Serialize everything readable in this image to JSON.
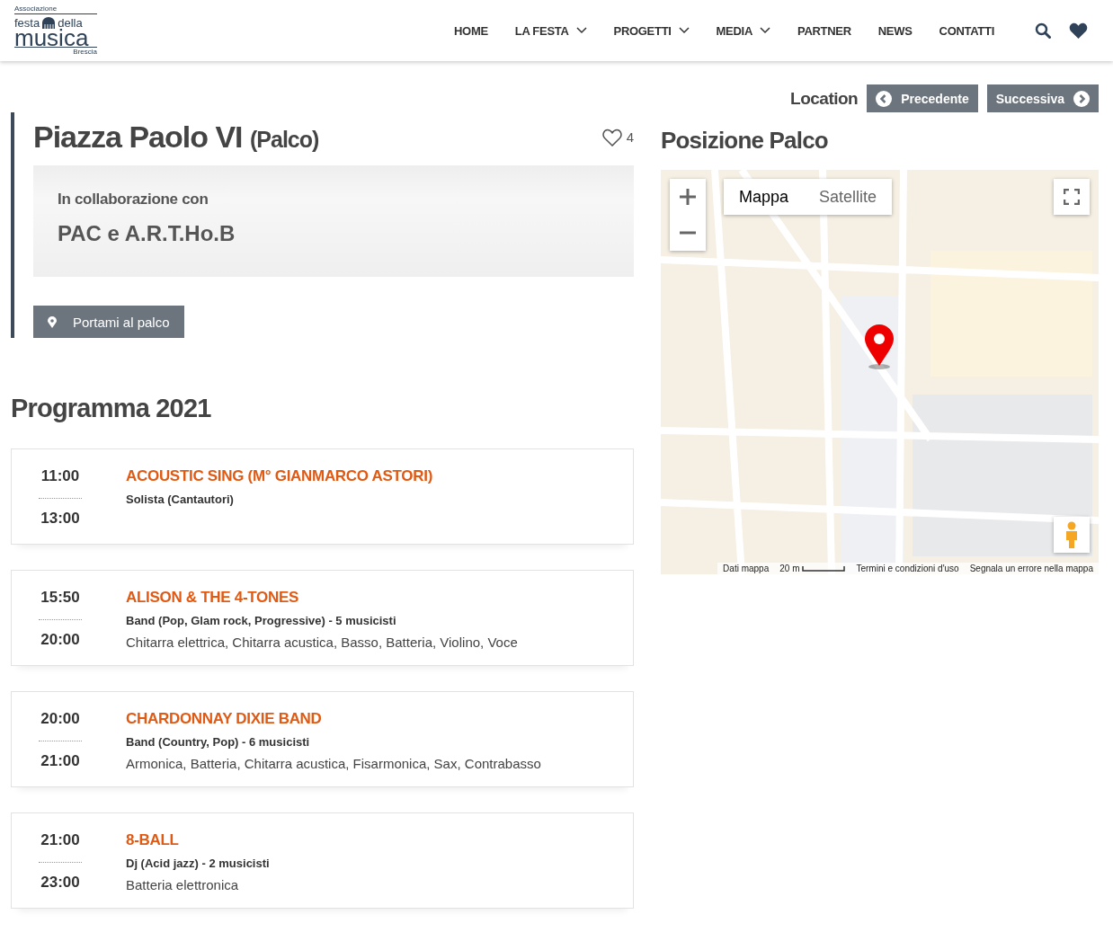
{
  "logo": {
    "top": "Associazione",
    "left": "festa",
    "right": "della",
    "main": "musica",
    "bottom": "Brescia"
  },
  "nav": [
    {
      "label": "HOME",
      "has_dropdown": false
    },
    {
      "label": "LA FESTA",
      "has_dropdown": true
    },
    {
      "label": "PROGETTI",
      "has_dropdown": true
    },
    {
      "label": "MEDIA",
      "has_dropdown": true
    },
    {
      "label": "PARTNER",
      "has_dropdown": false
    },
    {
      "label": "NEWS",
      "has_dropdown": false
    },
    {
      "label": "CONTATTI",
      "has_dropdown": false
    }
  ],
  "location_nav": {
    "label": "Location",
    "prev": "Precedente",
    "next": "Successiva"
  },
  "venue": {
    "title": "Piazza Paolo VI",
    "subtitle": "(Palco)",
    "likes": "4",
    "collab_label": "In collaborazione con",
    "collab_name": "PAC e A.R.T.Ho.B",
    "directions_button": "Portami al palco"
  },
  "map_section": {
    "title": "Posizione Palco",
    "map_types": [
      {
        "label": "Mappa",
        "selected": true
      },
      {
        "label": "Satellite",
        "selected": false
      }
    ],
    "footer": [
      "Dati mappa",
      "20 m",
      "Termini e condizioni d'uso",
      "Segnala un errore nella mappa"
    ]
  },
  "program": {
    "title": "Programma 2021",
    "events": [
      {
        "start": "11:00",
        "end": "13:00",
        "title": "ACOUSTIC SING (M° GIANMARCO ASTORI)",
        "details": "Solista (Cantautori)"
      },
      {
        "start": "15:50",
        "end": "20:00",
        "title": "ALISON & THE 4-TONES",
        "details": "Band (Pop, Glam rock, Progressive) - 5 musicisti",
        "instruments": "Chitarra elettrica, Chitarra acustica, Basso, Batteria, Violino, Voce"
      },
      {
        "start": "20:00",
        "end": "21:00",
        "title": "CHARDONNAY DIXIE BAND",
        "details": "Band (Country, Pop) - 6 musicisti",
        "instruments": "Armonica, Batteria, Chitarra acustica, Fisarmonica, Sax, Contrabasso"
      },
      {
        "start": "21:00",
        "end": "23:00",
        "title": "8-BALL",
        "details": "Dj (Acid jazz) - 2 musicisti",
        "instruments": "Batteria elettronica"
      }
    ]
  }
}
